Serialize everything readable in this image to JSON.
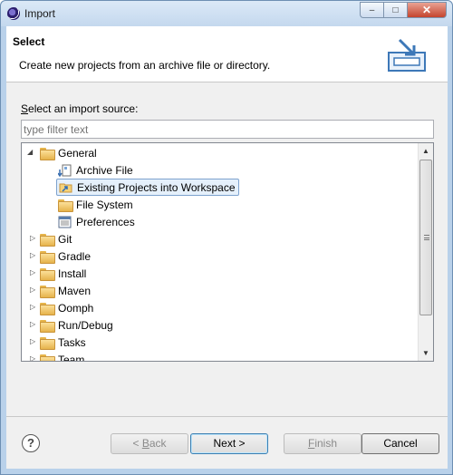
{
  "window": {
    "title": "Import",
    "minimize": "–",
    "maximize": "□",
    "close": "✕"
  },
  "header": {
    "title": "Select",
    "description": "Create new projects from an archive file or directory."
  },
  "source": {
    "label_first": "S",
    "label_rest": "elect an import source:",
    "filter_placeholder": "type filter text"
  },
  "tree": {
    "general": {
      "label": "General",
      "children": [
        {
          "label": "Archive File",
          "icon": "archive-file-icon"
        },
        {
          "label": "Existing Projects into Workspace",
          "icon": "project-folder-icon",
          "selected": true
        },
        {
          "label": "File System",
          "icon": "folder-icon"
        },
        {
          "label": "Preferences",
          "icon": "preferences-icon"
        }
      ]
    },
    "categories": [
      "Git",
      "Gradle",
      "Install",
      "Maven",
      "Oomph",
      "Run/Debug",
      "Tasks",
      "Team"
    ]
  },
  "footer": {
    "help": "?",
    "back_prefix": "< ",
    "back_key": "B",
    "back_rest": "ack",
    "next": "Next >",
    "finish_key": "F",
    "finish_rest": "inish",
    "cancel": "Cancel"
  }
}
